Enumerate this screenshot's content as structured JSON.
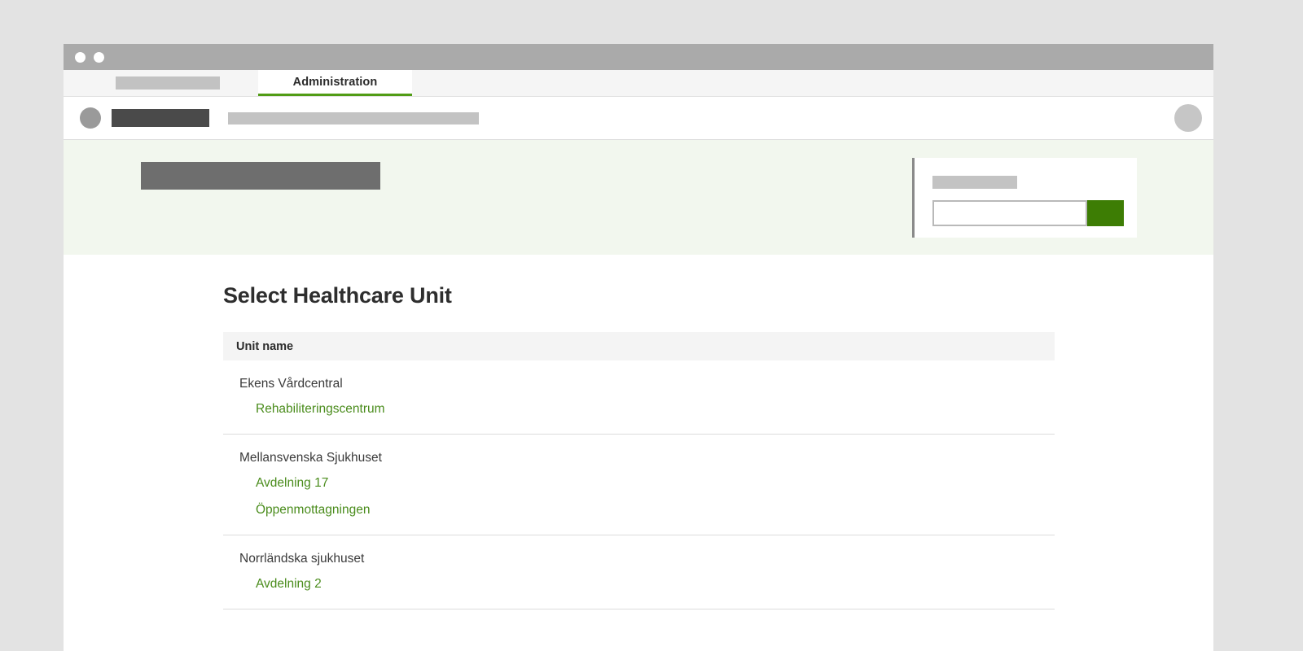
{
  "window": {
    "dots": [
      "window-dot-1",
      "window-dot-2"
    ]
  },
  "tabs": {
    "inactive_placeholder_label": "",
    "active_label": "Administration"
  },
  "appbar": {
    "logo_placeholder": "",
    "title_placeholder": "",
    "nav_placeholder": "",
    "user_avatar_placeholder": ""
  },
  "hero": {
    "banner_placeholder": "",
    "search": {
      "label_placeholder": "",
      "input_value": "",
      "input_placeholder": "",
      "button_label": "",
      "button_color": "#3d7d04"
    }
  },
  "main": {
    "page_title": "Select Healthcare Unit",
    "table": {
      "columns": [
        "Unit name"
      ],
      "groups": [
        {
          "parent": "Ekens Vårdcentral",
          "children": [
            "Rehabiliteringscentrum"
          ]
        },
        {
          "parent": "Mellansvenska Sjukhuset",
          "children": [
            "Avdelning 17",
            "Öppenmottagningen"
          ]
        },
        {
          "parent": "Norrländska sjukhuset",
          "children": [
            "Avdelning 2"
          ]
        }
      ]
    }
  },
  "colors": {
    "accent_green": "#4a8c1c",
    "tab_underline_green": "#519c15",
    "button_green": "#3d7d04",
    "hero_background": "#f2f7ee",
    "page_background": "#e3e3e3"
  }
}
